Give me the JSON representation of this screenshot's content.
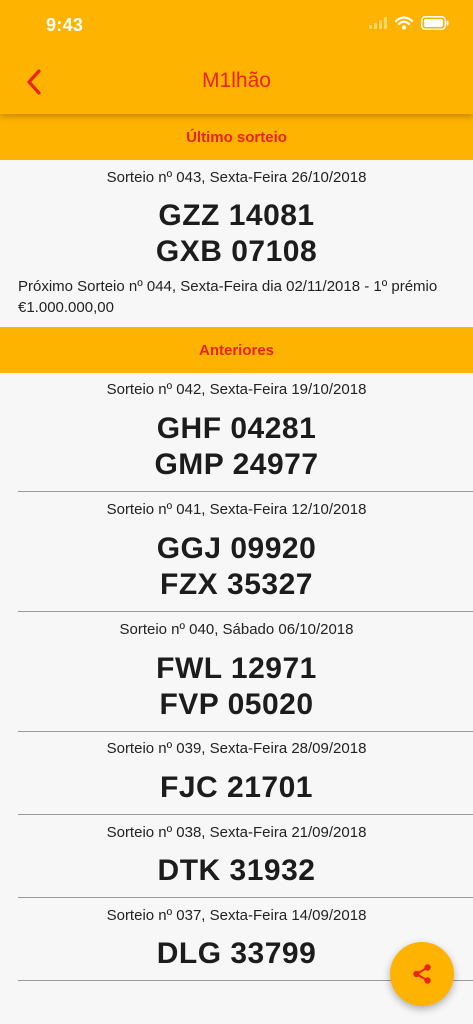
{
  "status_bar": {
    "time": "9:43"
  },
  "nav": {
    "title": "M1lhão"
  },
  "latest": {
    "header": "Último sorteio",
    "date": "Sorteio nº 043, Sexta-Feira 26/10/2018",
    "codes": [
      "GZZ 14081",
      "GXB 07108"
    ],
    "next": "Próximo Sorteio nº 044, Sexta-Feira dia 02/11/2018 - 1º prémio €1.000.000,00"
  },
  "previous": {
    "header": "Anteriores",
    "items": [
      {
        "date": "Sorteio nº 042, Sexta-Feira 19/10/2018",
        "codes": [
          "GHF 04281",
          "GMP 24977"
        ]
      },
      {
        "date": "Sorteio nº 041, Sexta-Feira 12/10/2018",
        "codes": [
          "GGJ 09920",
          "FZX 35327"
        ]
      },
      {
        "date": "Sorteio nº 040, Sábado 06/10/2018",
        "codes": [
          "FWL 12971",
          "FVP 05020"
        ]
      },
      {
        "date": "Sorteio nº 039, Sexta-Feira 28/09/2018",
        "codes": [
          "FJC 21701"
        ]
      },
      {
        "date": "Sorteio nº 038, Sexta-Feira 21/09/2018",
        "codes": [
          "DTK 31932"
        ]
      },
      {
        "date": "Sorteio nº 037, Sexta-Feira 14/09/2018",
        "codes": [
          "DLG 33799"
        ]
      }
    ]
  },
  "icons": {
    "back": "chevron-left-icon",
    "share": "share-icon",
    "wifi": "wifi-icon",
    "signal": "signal-icon",
    "battery": "battery-icon"
  },
  "colors": {
    "accent": "#ffb301",
    "title": "#e8251a",
    "background": "#f7f7f7"
  }
}
